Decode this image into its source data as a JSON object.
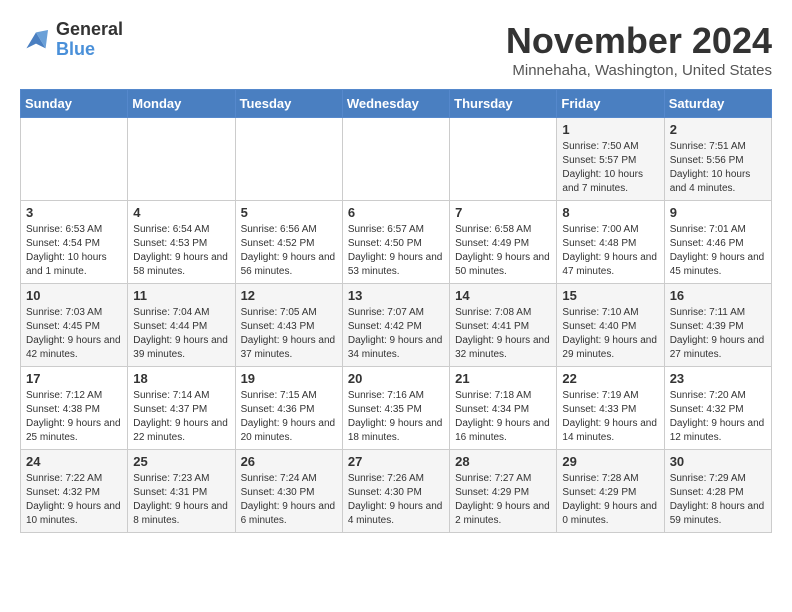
{
  "logo": {
    "line1": "General",
    "line2": "Blue"
  },
  "title": "November 2024",
  "location": "Minnehaha, Washington, United States",
  "weekdays": [
    "Sunday",
    "Monday",
    "Tuesday",
    "Wednesday",
    "Thursday",
    "Friday",
    "Saturday"
  ],
  "weeks": [
    [
      {
        "day": "",
        "info": ""
      },
      {
        "day": "",
        "info": ""
      },
      {
        "day": "",
        "info": ""
      },
      {
        "day": "",
        "info": ""
      },
      {
        "day": "",
        "info": ""
      },
      {
        "day": "1",
        "info": "Sunrise: 7:50 AM\nSunset: 5:57 PM\nDaylight: 10 hours and 7 minutes."
      },
      {
        "day": "2",
        "info": "Sunrise: 7:51 AM\nSunset: 5:56 PM\nDaylight: 10 hours and 4 minutes."
      }
    ],
    [
      {
        "day": "3",
        "info": "Sunrise: 6:53 AM\nSunset: 4:54 PM\nDaylight: 10 hours and 1 minute."
      },
      {
        "day": "4",
        "info": "Sunrise: 6:54 AM\nSunset: 4:53 PM\nDaylight: 9 hours and 58 minutes."
      },
      {
        "day": "5",
        "info": "Sunrise: 6:56 AM\nSunset: 4:52 PM\nDaylight: 9 hours and 56 minutes."
      },
      {
        "day": "6",
        "info": "Sunrise: 6:57 AM\nSunset: 4:50 PM\nDaylight: 9 hours and 53 minutes."
      },
      {
        "day": "7",
        "info": "Sunrise: 6:58 AM\nSunset: 4:49 PM\nDaylight: 9 hours and 50 minutes."
      },
      {
        "day": "8",
        "info": "Sunrise: 7:00 AM\nSunset: 4:48 PM\nDaylight: 9 hours and 47 minutes."
      },
      {
        "day": "9",
        "info": "Sunrise: 7:01 AM\nSunset: 4:46 PM\nDaylight: 9 hours and 45 minutes."
      }
    ],
    [
      {
        "day": "10",
        "info": "Sunrise: 7:03 AM\nSunset: 4:45 PM\nDaylight: 9 hours and 42 minutes."
      },
      {
        "day": "11",
        "info": "Sunrise: 7:04 AM\nSunset: 4:44 PM\nDaylight: 9 hours and 39 minutes."
      },
      {
        "day": "12",
        "info": "Sunrise: 7:05 AM\nSunset: 4:43 PM\nDaylight: 9 hours and 37 minutes."
      },
      {
        "day": "13",
        "info": "Sunrise: 7:07 AM\nSunset: 4:42 PM\nDaylight: 9 hours and 34 minutes."
      },
      {
        "day": "14",
        "info": "Sunrise: 7:08 AM\nSunset: 4:41 PM\nDaylight: 9 hours and 32 minutes."
      },
      {
        "day": "15",
        "info": "Sunrise: 7:10 AM\nSunset: 4:40 PM\nDaylight: 9 hours and 29 minutes."
      },
      {
        "day": "16",
        "info": "Sunrise: 7:11 AM\nSunset: 4:39 PM\nDaylight: 9 hours and 27 minutes."
      }
    ],
    [
      {
        "day": "17",
        "info": "Sunrise: 7:12 AM\nSunset: 4:38 PM\nDaylight: 9 hours and 25 minutes."
      },
      {
        "day": "18",
        "info": "Sunrise: 7:14 AM\nSunset: 4:37 PM\nDaylight: 9 hours and 22 minutes."
      },
      {
        "day": "19",
        "info": "Sunrise: 7:15 AM\nSunset: 4:36 PM\nDaylight: 9 hours and 20 minutes."
      },
      {
        "day": "20",
        "info": "Sunrise: 7:16 AM\nSunset: 4:35 PM\nDaylight: 9 hours and 18 minutes."
      },
      {
        "day": "21",
        "info": "Sunrise: 7:18 AM\nSunset: 4:34 PM\nDaylight: 9 hours and 16 minutes."
      },
      {
        "day": "22",
        "info": "Sunrise: 7:19 AM\nSunset: 4:33 PM\nDaylight: 9 hours and 14 minutes."
      },
      {
        "day": "23",
        "info": "Sunrise: 7:20 AM\nSunset: 4:32 PM\nDaylight: 9 hours and 12 minutes."
      }
    ],
    [
      {
        "day": "24",
        "info": "Sunrise: 7:22 AM\nSunset: 4:32 PM\nDaylight: 9 hours and 10 minutes."
      },
      {
        "day": "25",
        "info": "Sunrise: 7:23 AM\nSunset: 4:31 PM\nDaylight: 9 hours and 8 minutes."
      },
      {
        "day": "26",
        "info": "Sunrise: 7:24 AM\nSunset: 4:30 PM\nDaylight: 9 hours and 6 minutes."
      },
      {
        "day": "27",
        "info": "Sunrise: 7:26 AM\nSunset: 4:30 PM\nDaylight: 9 hours and 4 minutes."
      },
      {
        "day": "28",
        "info": "Sunrise: 7:27 AM\nSunset: 4:29 PM\nDaylight: 9 hours and 2 minutes."
      },
      {
        "day": "29",
        "info": "Sunrise: 7:28 AM\nSunset: 4:29 PM\nDaylight: 9 hours and 0 minutes."
      },
      {
        "day": "30",
        "info": "Sunrise: 7:29 AM\nSunset: 4:28 PM\nDaylight: 8 hours and 59 minutes."
      }
    ]
  ]
}
